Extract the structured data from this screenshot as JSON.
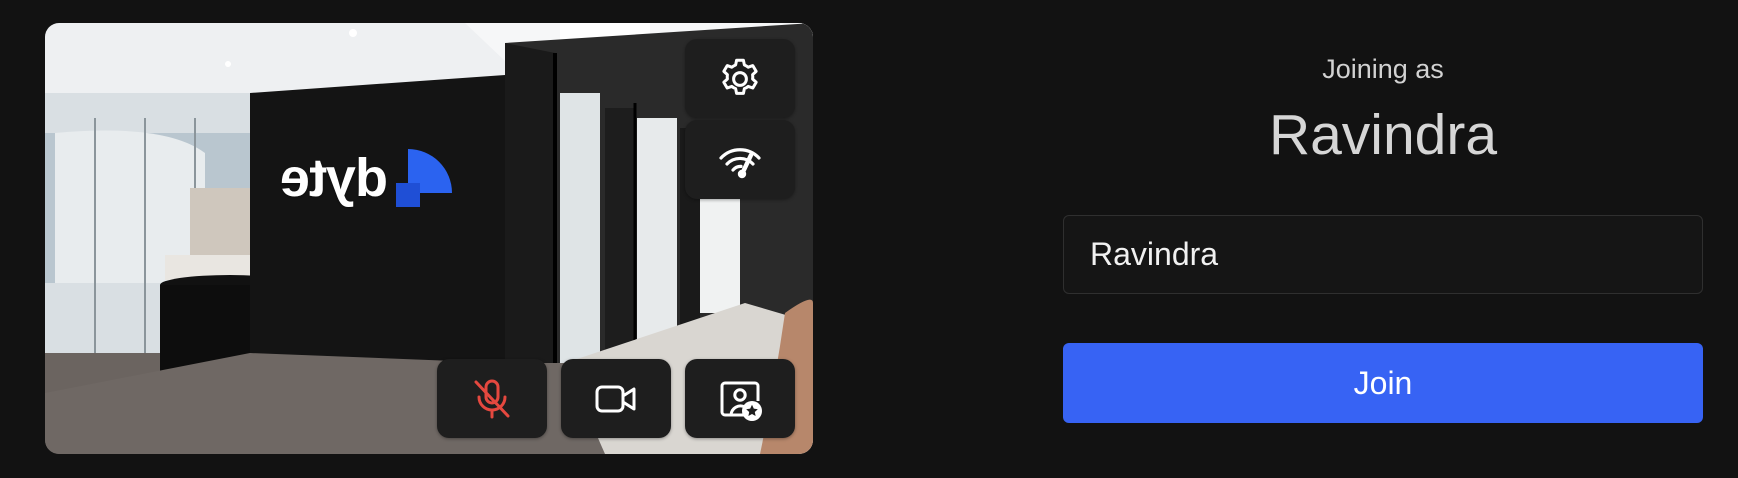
{
  "preview": {
    "logo_text": "dyte",
    "brand_color": "#2b63f0"
  },
  "controls": {
    "settings": {
      "icon": "gear-icon"
    },
    "network": {
      "icon": "network-quality-icon"
    },
    "microphone": {
      "icon": "mic-off-icon",
      "state": "muted",
      "color": "#e5483f"
    },
    "camera": {
      "icon": "video-camera-icon",
      "state": "on"
    },
    "effects": {
      "icon": "user-star-icon"
    }
  },
  "join_panel": {
    "joining_label": "Joining as",
    "display_name": "Ravindra",
    "name_input_value": "Ravindra",
    "join_label": "Join",
    "accent_color": "#3763f4"
  }
}
